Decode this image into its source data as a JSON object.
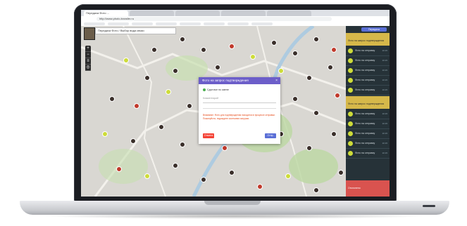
{
  "browser": {
    "tabs": [
      "Передача Фото ...",
      "",
      "",
      "",
      ""
    ],
    "url": "http://www.photo-transfer.ru"
  },
  "map_header": {
    "title": "Передача Фото / Выбор вида связи"
  },
  "zoom": {
    "plus": "+",
    "minus": "−"
  },
  "panel": {
    "button": "Передача",
    "sections": [
      {
        "title": "Фото на запрос подтверждения",
        "items": [
          "Фото на отправку",
          "Фото на отправку",
          "Фото на отправку",
          "Фото на отправку",
          "Фото на отправку"
        ]
      },
      {
        "title": "Фото на запрос подтверждения",
        "items": [
          "Фото на отправку",
          "Фото на отправку",
          "Фото на отправку",
          "Фото на отправку",
          "Фото на отправку"
        ]
      },
      {
        "title": "Отклонено"
      }
    ],
    "time": "10:15"
  },
  "modal": {
    "title": "Фото на запрос подтверждения",
    "close": "×",
    "user": "Сдал все по смене",
    "field_placeholder": "Комментарий",
    "warning": "Внимание: Фото для подтверждения находится в процессе отправки. Пожалуйста, подождите окончания загрузки.",
    "cancel": "Отмена",
    "ok": "Отпр."
  },
  "colors": {
    "accent": "#6c5ec9",
    "panel_yellow": "#d6b84a",
    "panel_red": "#d9534f",
    "panel_bg": "#263238"
  }
}
